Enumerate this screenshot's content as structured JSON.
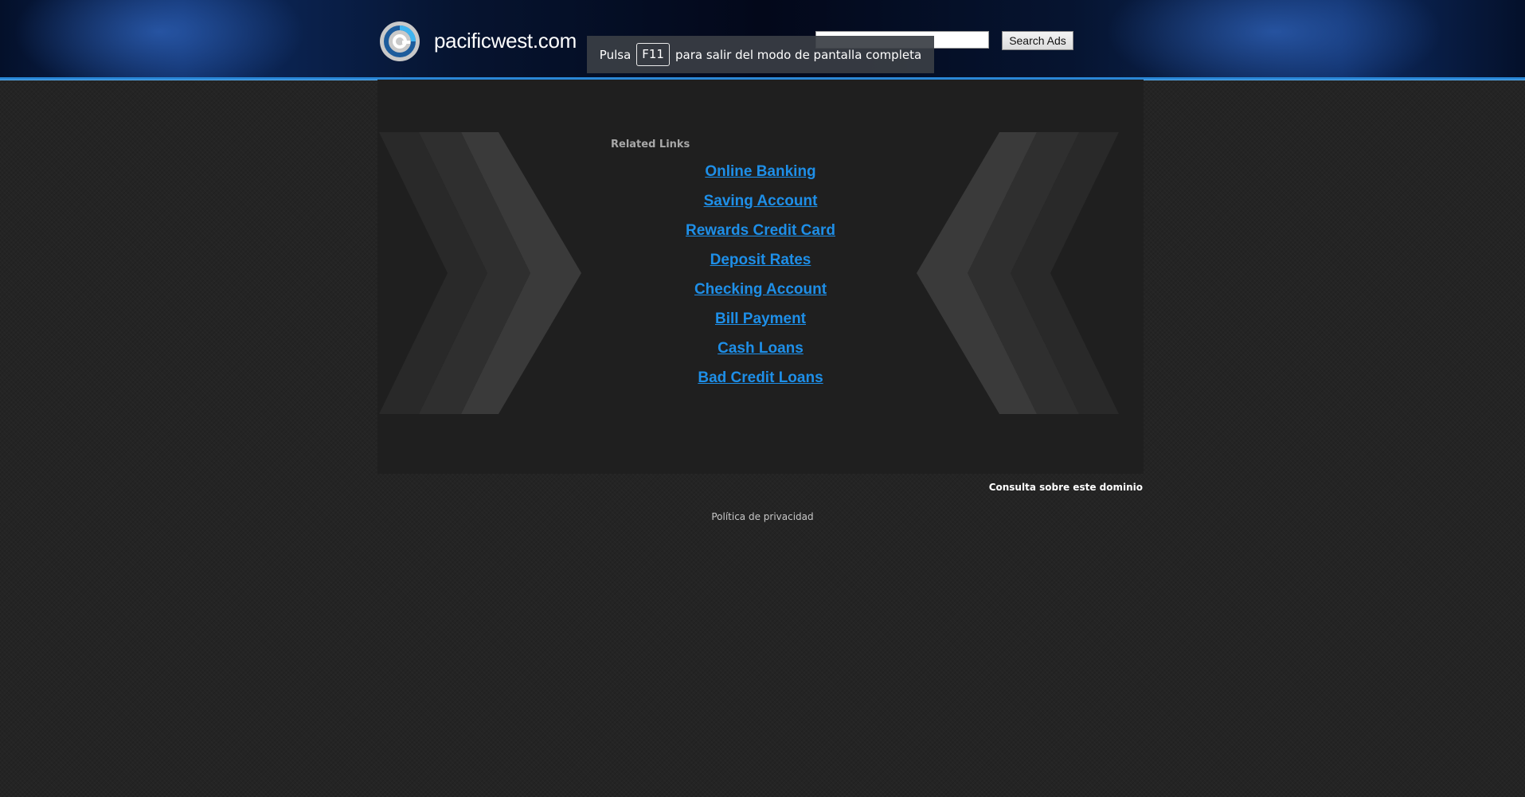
{
  "header": {
    "site_name": "pacificwest.com",
    "search_placeholder": "",
    "search_button_label": "Search Ads",
    "accent_color": "#2a87d6"
  },
  "fullscreen_notice": {
    "prefix": "Pulsa",
    "key": "F11",
    "suffix": "para salir del modo de pantalla completa"
  },
  "main": {
    "related_heading": "Related Links",
    "links": [
      {
        "label": "Online Banking"
      },
      {
        "label": "Saving Account"
      },
      {
        "label": "Rewards Credit Card"
      },
      {
        "label": "Deposit Rates"
      },
      {
        "label": "Checking Account"
      },
      {
        "label": "Bill Payment"
      },
      {
        "label": "Cash Loans"
      },
      {
        "label": "Bad Credit Loans"
      }
    ],
    "link_color": "#1e8fe8"
  },
  "footer": {
    "domain_inquiry": "Consulta sobre este dominio",
    "privacy": "Política de privacidad"
  }
}
